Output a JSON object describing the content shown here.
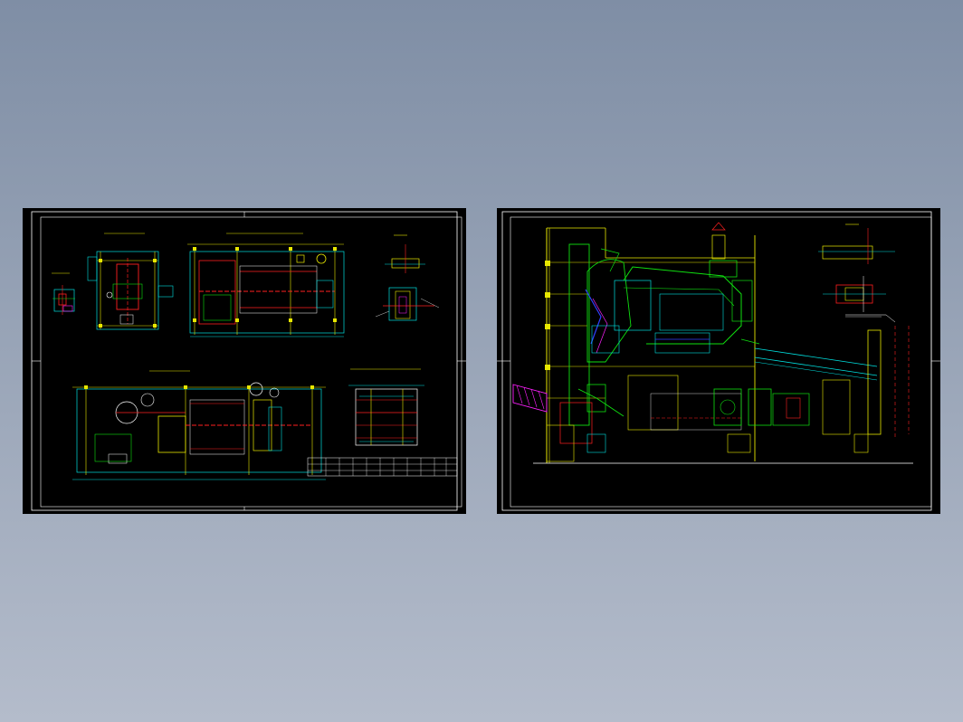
{
  "drawings": {
    "left": {},
    "right": {}
  },
  "colors": {
    "background_top": "#7f8ea5",
    "background_bottom": "#b4bccb",
    "sheet": "#000000",
    "line_cyan": "#00e0e0",
    "line_yellow": "#e8e800",
    "line_red": "#ff2020",
    "line_green": "#10e010",
    "line_white": "#ffffff",
    "line_magenta": "#ff20ff",
    "line_blue": "#3040ff"
  }
}
